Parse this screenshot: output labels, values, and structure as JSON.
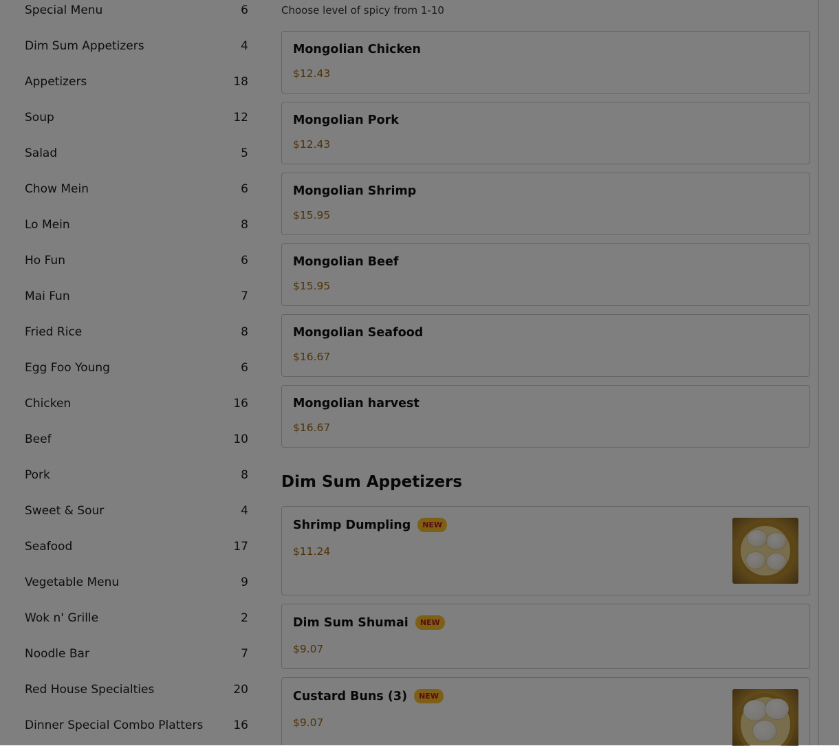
{
  "sidebar": {
    "categories": [
      {
        "label": "Special Menu",
        "count": "6"
      },
      {
        "label": "Dim Sum Appetizers",
        "count": "4"
      },
      {
        "label": "Appetizers",
        "count": "18"
      },
      {
        "label": "Soup",
        "count": "12"
      },
      {
        "label": "Salad",
        "count": "5"
      },
      {
        "label": "Chow Mein",
        "count": "6"
      },
      {
        "label": "Lo Mein",
        "count": "8"
      },
      {
        "label": "Ho Fun",
        "count": "6"
      },
      {
        "label": "Mai Fun",
        "count": "7"
      },
      {
        "label": "Fried Rice",
        "count": "8"
      },
      {
        "label": "Egg Foo Young",
        "count": "6"
      },
      {
        "label": "Chicken",
        "count": "16"
      },
      {
        "label": "Beef",
        "count": "10"
      },
      {
        "label": "Pork",
        "count": "8"
      },
      {
        "label": "Sweet & Sour",
        "count": "4"
      },
      {
        "label": "Seafood",
        "count": "17"
      },
      {
        "label": "Vegetable Menu",
        "count": "9"
      },
      {
        "label": "Wok n' Grille",
        "count": "2"
      },
      {
        "label": "Noodle Bar",
        "count": "7"
      },
      {
        "label": "Red House Specialties",
        "count": "20"
      },
      {
        "label": "Dinner Special Combo Platters",
        "count": "16"
      }
    ]
  },
  "main": {
    "note": "Choose level of spicy from 1-10",
    "items": [
      {
        "name": "Mongolian Chicken",
        "price": "$12.43"
      },
      {
        "name": "Mongolian Pork",
        "price": "$12.43"
      },
      {
        "name": "Mongolian Shrimp",
        "price": "$15.95"
      },
      {
        "name": "Mongolian Beef",
        "price": "$15.95"
      },
      {
        "name": "Mongolian Seafood",
        "price": "$16.67"
      },
      {
        "name": "Mongolian harvest",
        "price": "$16.67"
      }
    ],
    "dimsum_section": {
      "heading": "Dim Sum Appetizers",
      "items": [
        {
          "name": "Shrimp Dumpling",
          "badge": "NEW",
          "price": "$11.24",
          "image": "shrimp-dumpling-photo"
        },
        {
          "name": "Dim Sum Shumai",
          "badge": "NEW",
          "price": "$9.07"
        },
        {
          "name": "Custard Buns (3)",
          "badge": "NEW",
          "price": "$9.07",
          "image": "custard-buns-photo"
        }
      ]
    }
  },
  "overlay": {
    "color": "#000000",
    "opacity": 0.5
  },
  "colors": {
    "price": "#a1650f",
    "badge_bg": "#fbc02d",
    "badge_text": "#b21c1c"
  }
}
